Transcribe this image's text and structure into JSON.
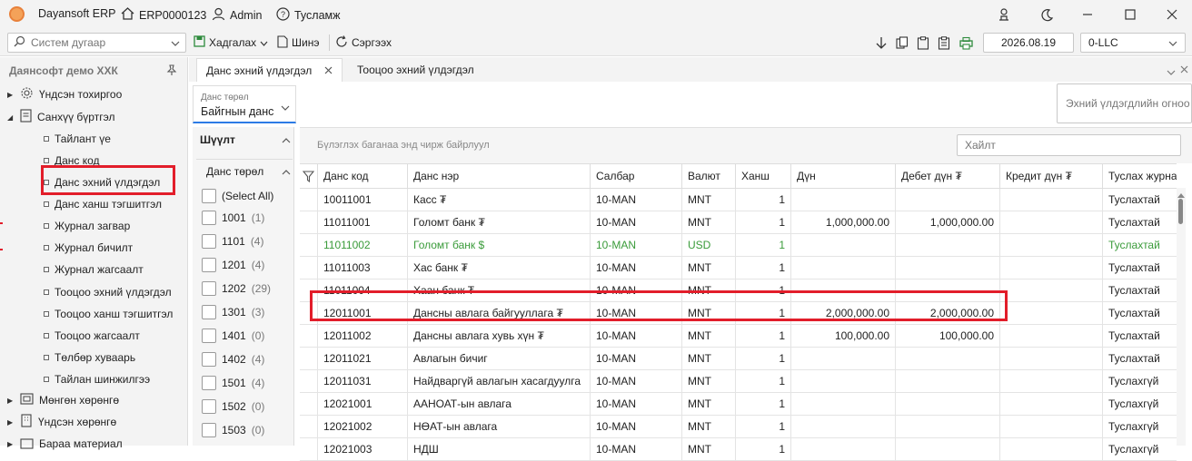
{
  "app": {
    "name": "Dayansoft ERP",
    "code": "ERP0000123",
    "user": "Admin",
    "help": "Тусламж"
  },
  "toolbar": {
    "search_placeholder": "Систем дугаар",
    "save_label": "Хадгалах",
    "new_label": "Шинэ",
    "refresh_label": "Сэргээх",
    "date": "2026.08.19",
    "company": "0-LLC"
  },
  "sidebar": {
    "title": "Даянсофт демо ХХК",
    "items": [
      {
        "label": "Үндсэн тохиргоо",
        "level": 0,
        "expand": "▶"
      },
      {
        "label": "Санхүү бүртгэл",
        "level": 0,
        "expand": "◢"
      },
      {
        "label": "Тайлант үе",
        "level": 1
      },
      {
        "label": "Данс код",
        "level": 1
      },
      {
        "label": "Данс эхний үлдэгдэл",
        "level": 1
      },
      {
        "label": "Данс ханш тэгшитгэл",
        "level": 1
      },
      {
        "label": "Журнал загвар",
        "level": 1
      },
      {
        "label": "Журнал бичилт",
        "level": 1
      },
      {
        "label": "Журнал жагсаалт",
        "level": 1
      },
      {
        "label": "Тооцоо эхний үлдэгдэл",
        "level": 1
      },
      {
        "label": "Тооцоо ханш тэгшитгэл",
        "level": 1
      },
      {
        "label": "Тооцоо жагсаалт",
        "level": 1
      },
      {
        "label": "Төлбөр хуваарь",
        "level": 1
      },
      {
        "label": "Тайлан шинжилгээ",
        "level": 1
      },
      {
        "label": "Мөнгөн хөрөнгө",
        "level": 0,
        "expand": "▶"
      },
      {
        "label": "Үндсэн хөрөнгө",
        "level": 0,
        "expand": "▶"
      },
      {
        "label": "Бараа материал",
        "level": 0,
        "expand": "▶"
      }
    ]
  },
  "tabs": [
    {
      "label": "Данс эхний үлдэгдэл"
    },
    {
      "label": "Тооцоо эхний үлдэгдэл"
    }
  ],
  "filter": {
    "type_caption": "Данс төрөл",
    "type_value": "Байгнын данс",
    "shuult": "Шүүлт",
    "group_title": "Данс төрөл",
    "options": [
      {
        "label": "(Select All)",
        "count": ""
      },
      {
        "label": "1001",
        "count": "(1)"
      },
      {
        "label": "1101",
        "count": "(4)"
      },
      {
        "label": "1201",
        "count": "(4)"
      },
      {
        "label": "1202",
        "count": "(29)"
      },
      {
        "label": "1301",
        "count": "(3)"
      },
      {
        "label": "1401",
        "count": "(0)"
      },
      {
        "label": "1402",
        "count": "(4)"
      },
      {
        "label": "1501",
        "count": "(4)"
      },
      {
        "label": "1502",
        "count": "(0)"
      },
      {
        "label": "1503",
        "count": "(0)"
      }
    ]
  },
  "grid": {
    "group_hint": "Бүлэглэх баганаа энд чирж байрлуул",
    "search_placeholder": "Хайлт",
    "right_button": "Эхний үлдэгдлийн огноо",
    "columns": [
      "Данс код",
      "Данс нэр",
      "Салбар",
      "Валют",
      "Ханш",
      "Дүн",
      "Дебет дүн ₮",
      "Кредит дүн ₮",
      "Туслах журнал"
    ],
    "rows": [
      {
        "code": "10011001",
        "name": "Касс ₮",
        "branch": "10-MAN",
        "currency": "MNT",
        "rate": "1",
        "amount": "",
        "debit": "",
        "credit": "",
        "journal": "Туслахтай"
      },
      {
        "code": "11011001",
        "name": "Голомт банк ₮",
        "branch": "10-MAN",
        "currency": "MNT",
        "rate": "1",
        "amount": "1,000,000.00",
        "debit": "1,000,000.00",
        "credit": "",
        "journal": "Туслахтай"
      },
      {
        "code": "11011002",
        "name": "Голомт банк $",
        "branch": "10-MAN",
        "currency": "USD",
        "rate": "1",
        "amount": "",
        "debit": "",
        "credit": "",
        "journal": "Туслахтай",
        "green": true
      },
      {
        "code": "11011003",
        "name": "Хас банк ₮",
        "branch": "10-MAN",
        "currency": "MNT",
        "rate": "1",
        "amount": "",
        "debit": "",
        "credit": "",
        "journal": "Туслахтай"
      },
      {
        "code": "11011004",
        "name": "Хаан банк ₮",
        "branch": "10-MAN",
        "currency": "MNT",
        "rate": "1",
        "amount": "",
        "debit": "",
        "credit": "",
        "journal": "Туслахтай"
      },
      {
        "code": "12011001",
        "name": "Дансны авлага байгууллага ₮",
        "branch": "10-MAN",
        "currency": "MNT",
        "rate": "1",
        "amount": "2,000,000.00",
        "debit": "2,000,000.00",
        "credit": "",
        "journal": "Туслахтай"
      },
      {
        "code": "12011002",
        "name": "Дансны авлага хувь хүн ₮",
        "branch": "10-MAN",
        "currency": "MNT",
        "rate": "1",
        "amount": "100,000.00",
        "debit": "100,000.00",
        "credit": "",
        "journal": "Туслахтай"
      },
      {
        "code": "12011021",
        "name": "Авлагын бичиг",
        "branch": "10-MAN",
        "currency": "MNT",
        "rate": "1",
        "amount": "",
        "debit": "",
        "credit": "",
        "journal": "Туслахтай"
      },
      {
        "code": "12011031",
        "name": "Найдваргүй авлагын хасагдуулга",
        "branch": "10-MAN",
        "currency": "MNT",
        "rate": "1",
        "amount": "",
        "debit": "",
        "credit": "",
        "journal": "Туслахгүй"
      },
      {
        "code": "12021001",
        "name": "ААНОАТ-ын авлага",
        "branch": "10-MAN",
        "currency": "MNT",
        "rate": "1",
        "amount": "",
        "debit": "",
        "credit": "",
        "journal": "Туслахгүй"
      },
      {
        "code": "12021002",
        "name": "НӨАТ-ын авлага",
        "branch": "10-MAN",
        "currency": "MNT",
        "rate": "1",
        "amount": "",
        "debit": "",
        "credit": "",
        "journal": "Туслахгүй"
      },
      {
        "code": "12021003",
        "name": "НДШ",
        "branch": "10-MAN",
        "currency": "MNT",
        "rate": "1",
        "amount": "",
        "debit": "",
        "credit": "",
        "journal": "Туслахгүй"
      }
    ]
  },
  "colors": {
    "accent": "#2c7be5",
    "highlight": "#e21d2a",
    "green": "#3a9b3a"
  }
}
